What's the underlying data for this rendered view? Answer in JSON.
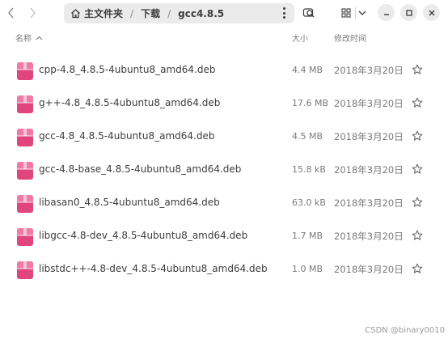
{
  "path": {
    "segments": [
      "主文件夹",
      "下载",
      "gcc4.8.5"
    ]
  },
  "columns": {
    "name": "名称",
    "size": "大小",
    "modified": "修改时间"
  },
  "files": [
    {
      "name": "cpp-4.8_4.8.5-4ubuntu8_amd64.deb",
      "size": "4.4 MB",
      "modified": "2018年3月20日"
    },
    {
      "name": "g++-4.8_4.8.5-4ubuntu8_amd64.deb",
      "size": "17.6 MB",
      "modified": "2018年3月20日"
    },
    {
      "name": "gcc-4.8_4.8.5-4ubuntu8_amd64.deb",
      "size": "4.5 MB",
      "modified": "2018年3月20日"
    },
    {
      "name": "gcc-4.8-base_4.8.5-4ubuntu8_amd64.deb",
      "size": "15.8 kB",
      "modified": "2018年3月20日"
    },
    {
      "name": "libasan0_4.8.5-4ubuntu8_amd64.deb",
      "size": "63.0 kB",
      "modified": "2018年3月20日"
    },
    {
      "name": "libgcc-4.8-dev_4.8.5-4ubuntu8_amd64.deb",
      "size": "1.7 MB",
      "modified": "2018年3月20日"
    },
    {
      "name": "libstdc++-4.8-dev_4.8.5-4ubuntu8_amd64.deb",
      "size": "1.0 MB",
      "modified": "2018年3月20日"
    }
  ],
  "watermark": "CSDN @binary0010",
  "colors": {
    "package_icon": "#e0467c",
    "package_icon_light": "#f07aa4",
    "pathbar_bg": "#ebebeb",
    "text": "#3d3d3d",
    "muted": "#7a7a7a"
  }
}
